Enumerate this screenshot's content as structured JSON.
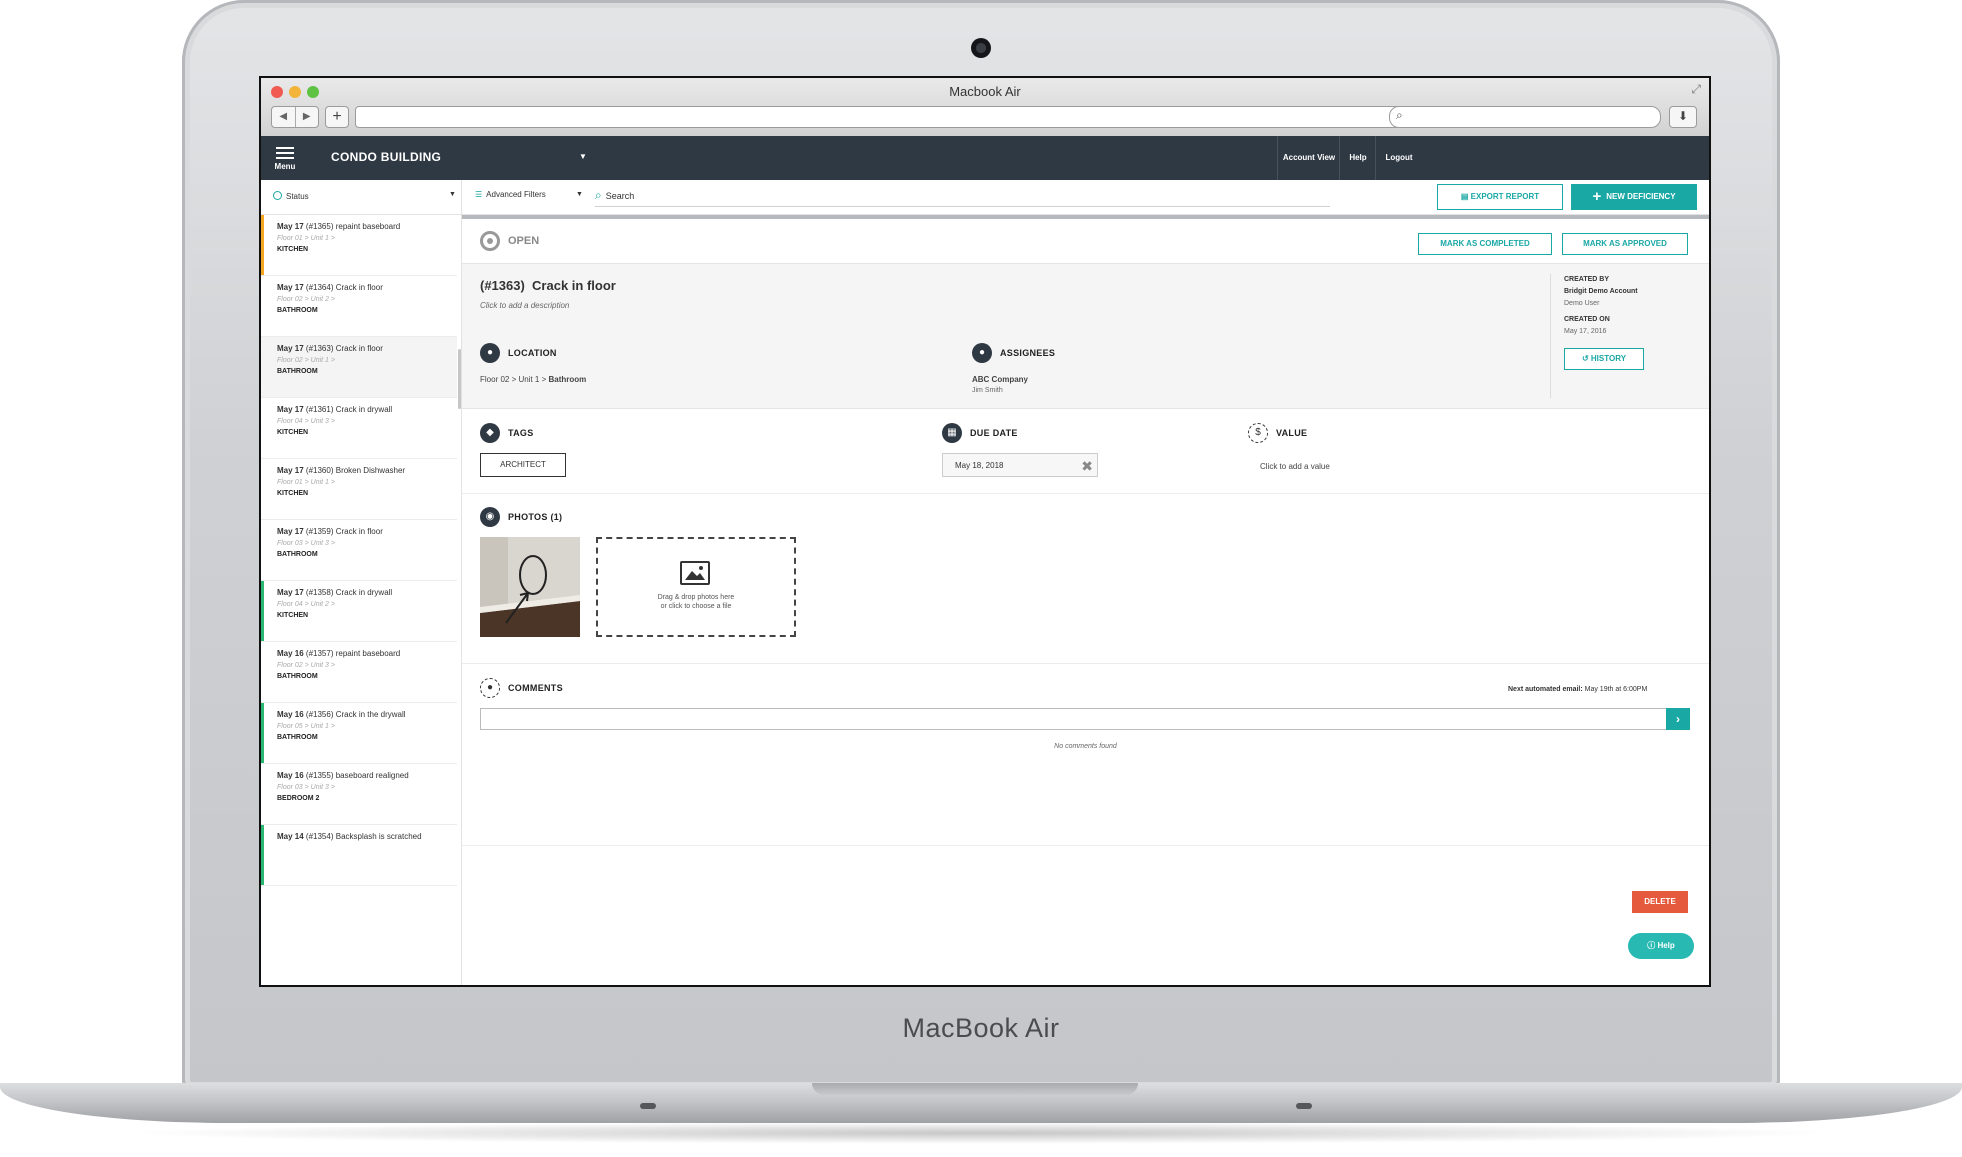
{
  "device": {
    "brand_label": "MacBook Air"
  },
  "browser": {
    "window_title": "Macbook Air"
  },
  "colors": {
    "accent": "#1aa8a4",
    "header": "#2f3944",
    "delete": "#e55a3c",
    "orange": "#f5a623",
    "green": "#2bb673",
    "gray": "#c7c7c7"
  },
  "app": {
    "menu_label": "Menu",
    "project_name": "CONDO BUILDING",
    "header_links": [
      "Account View",
      "Help",
      "Logout"
    ]
  },
  "toolbar": {
    "status_filter": "Status",
    "advanced_filters": "Advanced Filters",
    "search_placeholder": "Search",
    "export_label": "EXPORT REPORT",
    "new_label": "NEW DEFICIENCY"
  },
  "deficiencies": [
    {
      "date": "May 17",
      "id": "(#1365)",
      "title": "repaint baseboard",
      "path": "Floor 01 > Unit 1 >",
      "room": "KITCHEN",
      "status_color": "orange"
    },
    {
      "date": "May 17",
      "id": "(#1364)",
      "title": "Crack in floor",
      "path": "Floor 02 > Unit 2 >",
      "room": "BATHROOM",
      "status_color": "gray"
    },
    {
      "date": "May 17",
      "id": "(#1363)",
      "title": "Crack in floor",
      "path": "Floor 02 > Unit 1 >",
      "room": "BATHROOM",
      "status_color": "gray"
    },
    {
      "date": "May 17",
      "id": "(#1361)",
      "title": "Crack in drywall",
      "path": "Floor 04 > Unit 3 >",
      "room": "KITCHEN",
      "status_color": "gray"
    },
    {
      "date": "May 17",
      "id": "(#1360)",
      "title": "Broken Dishwasher",
      "path": "Floor 01 > Unit 1 >",
      "room": "KITCHEN",
      "status_color": "gray"
    },
    {
      "date": "May 17",
      "id": "(#1359)",
      "title": "Crack in floor",
      "path": "Floor 03 > Unit 3 >",
      "room": "BATHROOM",
      "status_color": "gray"
    },
    {
      "date": "May 17",
      "id": "(#1358)",
      "title": "Crack in drywall",
      "path": "Floor 04 > Unit 2 >",
      "room": "KITCHEN",
      "status_color": "green"
    },
    {
      "date": "May 16",
      "id": "(#1357)",
      "title": "repaint baseboard",
      "path": "Floor 02 > Unit 3 >",
      "room": "BATHROOM",
      "status_color": "gray"
    },
    {
      "date": "May 16",
      "id": "(#1356)",
      "title": "Crack in the drywall",
      "path": "Floor 05 > Unit 1 >",
      "room": "BATHROOM",
      "status_color": "green"
    },
    {
      "date": "May 16",
      "id": "(#1355)",
      "title": "baseboard realigned",
      "path": "Floor 03 > Unit 3 >",
      "room": "BEDROOM 2",
      "status_color": "gray"
    },
    {
      "date": "May 14",
      "id": "(#1354)",
      "title": "Backsplash is scratched",
      "path": "",
      "room": "",
      "status_color": "green"
    }
  ],
  "selected_index": 2,
  "detail": {
    "status": "OPEN",
    "mark_completed": "MARK AS COMPLETED",
    "mark_approved": "MARK AS APPROVED",
    "number": "(#1363)",
    "title": "Crack in floor",
    "description_placeholder": "Click to add a description",
    "location_label": "LOCATION",
    "location_path": "Floor 02 > Unit 1 >",
    "location_room": "Bathroom",
    "assignees_label": "ASSIGNEES",
    "assignee_company": "ABC Company",
    "assignee_person": "Jim Smith",
    "created_by_label": "CREATED BY",
    "created_by_account": "Bridgit Demo Account",
    "created_by_user": "Demo User",
    "created_on_label": "CREATED ON",
    "created_on_date": "May 17, 2016",
    "history_label": "HISTORY",
    "tags_label": "TAGS",
    "tag": "ARCHITECT",
    "due_date_label": "DUE DATE",
    "due_date": "May 18, 2018",
    "value_label": "VALUE",
    "value_placeholder": "Click to add a value",
    "photos_label": "PHOTOS (1)",
    "dropzone_line1": "Drag & drop photos here",
    "dropzone_line2": "or click to choose a file",
    "comments_label": "COMMENTS",
    "next_email_label": "Next automated email:",
    "next_email_value": "May 19th at 6:00PM",
    "no_comments": "No comments found",
    "delete_label": "DELETE",
    "help_label": "Help"
  }
}
